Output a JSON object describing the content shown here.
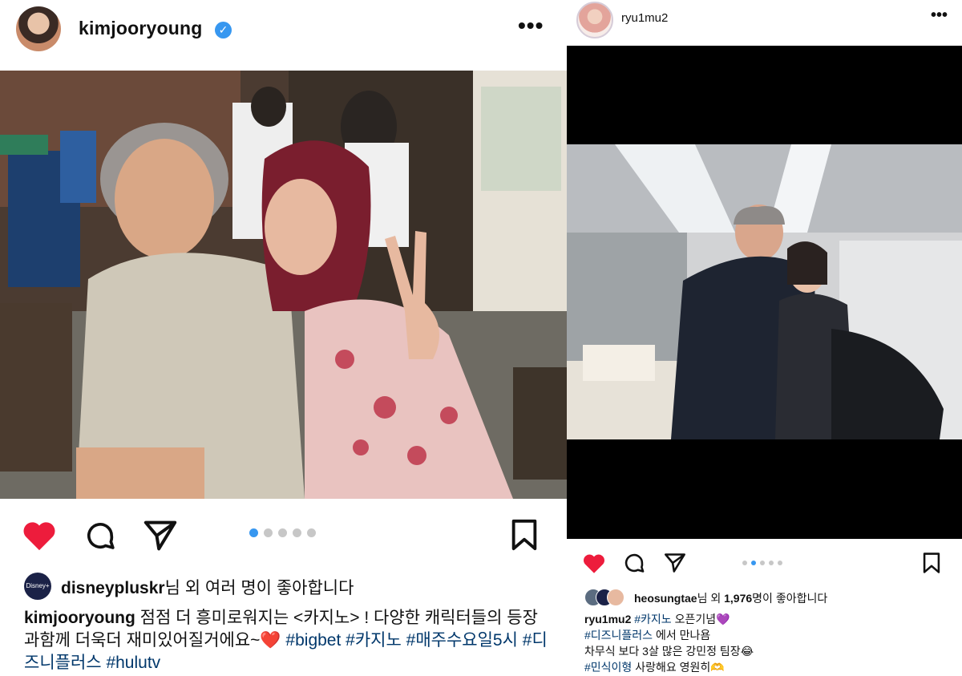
{
  "left_post": {
    "username": "kimjooryoung",
    "verified_mark": "✓",
    "more": "•••",
    "pagination": {
      "count": 5,
      "active": 0
    },
    "likes": {
      "avatar_label": "Disney+",
      "user": "disneypluskr",
      "text": "님 외 여러 명이 좋아합니다"
    },
    "caption": {
      "user": "kimjooryoung",
      "text": " 점점 더 흥미로워지는 <카지노> ! 다양한 캐릭터들의 등장과함께 더욱더 재미있어질거에요~",
      "emoji": "❤️",
      "tags": [
        "#bigbet",
        "#카지노",
        "#매주수요일5시",
        "#디즈니플러스",
        "#hulutv"
      ]
    }
  },
  "right_post": {
    "username": "ryu1mu2",
    "more": "•••",
    "pagination": {
      "count": 5,
      "active": 1
    },
    "likes": {
      "user": "heosungtae",
      "pre": "님 외 ",
      "count": "1,976",
      "post": "명이 좋아합니다"
    },
    "caption": {
      "user": "ryu1mu2",
      "tag1": "#카지노",
      "line1_rest": " 오픈기념",
      "emoji1": "💜",
      "tag2": "#디즈니플러스",
      "line2_rest": " 에서 만나욤",
      "line3": "차무식 보다 3살 많은 강민정 팀장",
      "emoji3": "😂",
      "tag4": "#민식이형",
      "line4_rest": " 사랑해요 영원히",
      "emoji4": "🫶"
    }
  },
  "colors": {
    "like_red": "#ed1c3c",
    "link_blue": "#00376b",
    "dot_active": "#3797f0",
    "dot_inactive": "#c7c7c7"
  }
}
